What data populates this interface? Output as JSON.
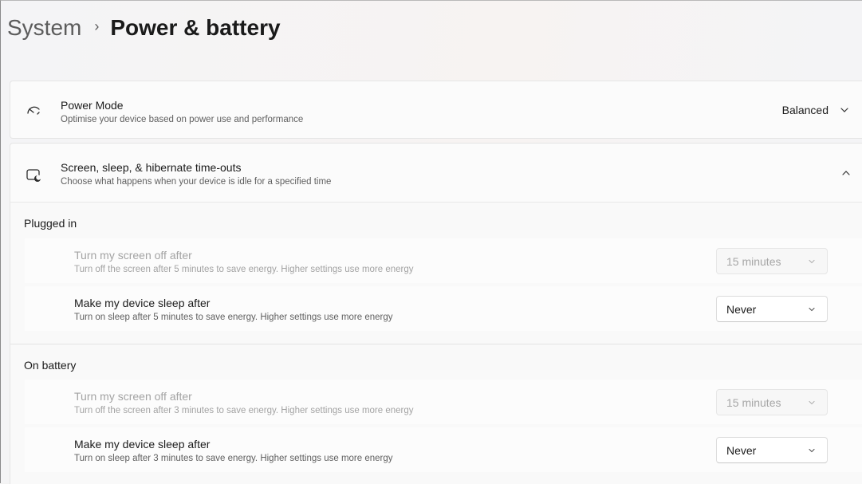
{
  "breadcrumb": {
    "parent": "System",
    "separator": "›",
    "current": "Power & battery"
  },
  "power_mode": {
    "title": "Power Mode",
    "description": "Optimise your device based on power use and performance",
    "value": "Balanced",
    "icon": "gauge-icon",
    "chevron": "chevron-down-icon"
  },
  "screen_sleep": {
    "title": "Screen, sleep, & hibernate time-outs",
    "description": "Choose what happens when your device is idle for a specified time",
    "icon": "screen-moon-icon",
    "expanded": true,
    "chevron": "chevron-up-icon"
  },
  "plugged_in": {
    "heading": "Plugged in",
    "screen_off": {
      "title": "Turn my screen off after",
      "description": "Turn off the screen after 5 minutes to save energy. Higher settings use more energy",
      "value": "15 minutes",
      "enabled": false
    },
    "sleep": {
      "title": "Make my device sleep after",
      "description": "Turn on sleep after 5 minutes to save energy. Higher settings use more energy",
      "value": "Never",
      "enabled": true
    }
  },
  "on_battery": {
    "heading": "On battery",
    "screen_off": {
      "title": "Turn my screen off after",
      "description": "Turn off the screen after 3 minutes to save energy. Higher settings use more energy",
      "value": "15 minutes",
      "enabled": false
    },
    "sleep": {
      "title": "Make my device sleep after",
      "description": "Turn on sleep after 3 minutes to save energy. Higher settings use more energy",
      "value": "Never",
      "enabled": true
    }
  },
  "colors": {
    "text_primary": "#1b1b1b",
    "text_secondary": "#5f5f5f",
    "text_disabled": "#a3a3a3",
    "card_background": "#fbfbfb"
  }
}
